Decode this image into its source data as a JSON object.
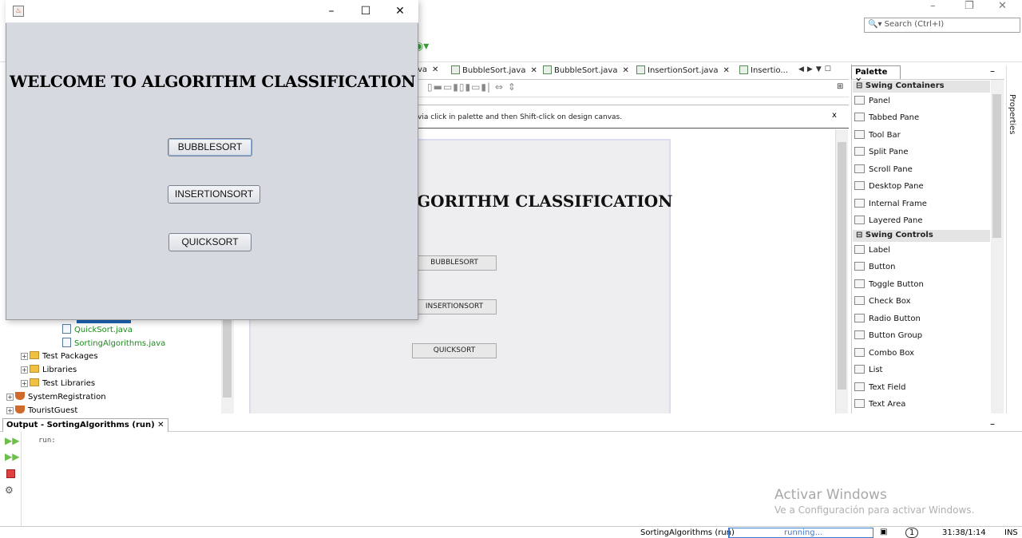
{
  "ide": {
    "search_placeholder": "Search (Ctrl+I)",
    "hint_text": "via click in palette and then Shift-click on design canvas.",
    "hint_close": "x"
  },
  "editor_tabs": [
    {
      "label": "va"
    },
    {
      "label": "BubbleSort.java"
    },
    {
      "label": "BubbleSort.java"
    },
    {
      "label": "InsertionSort.java"
    },
    {
      "label": "Insertio..."
    }
  ],
  "design_canvas": {
    "title": "GORITHM CLASSIFICATION",
    "buttons": [
      "BUBBLESORT",
      "INSERTIONSORT",
      "QUICKSORT"
    ]
  },
  "project_tree": {
    "items": [
      {
        "label": "QuickSort.java"
      },
      {
        "label": "SortingAlgorithms.java"
      },
      {
        "label": "Test Packages"
      },
      {
        "label": "Libraries"
      },
      {
        "label": "Test Libraries"
      },
      {
        "label": "SystemRegistration"
      },
      {
        "label": "TouristGuest"
      }
    ]
  },
  "palette": {
    "tab_label": "Palette",
    "categories": [
      {
        "label": "Swing Containers",
        "items": [
          "Panel",
          "Tabbed Pane",
          "Tool Bar",
          "Split Pane",
          "Scroll Pane",
          "Desktop Pane",
          "Internal Frame",
          "Layered Pane"
        ]
      },
      {
        "label": "Swing Controls",
        "items": [
          "Label",
          "Button",
          "Toggle Button",
          "Check Box",
          "Radio Button",
          "Button Group",
          "Combo Box",
          "List",
          "Text Field",
          "Text Area"
        ]
      }
    ],
    "properties_label": "Properties"
  },
  "output": {
    "tab_label": "Output - SortingAlgorithms (run)",
    "text": "run:",
    "watermark_title": "Activar Windows",
    "watermark_sub": "Ve a Configuración para activar Windows."
  },
  "status": {
    "project": "SortingAlgorithms (run)",
    "progress_text": "running...",
    "notifications": "1",
    "position": "31:38/1:14",
    "mode": "INS"
  },
  "dialog": {
    "heading": "WELCOME TO ALGORITHM CLASSIFICATION",
    "buttons": {
      "bubble": "BUBBLESORT",
      "insertion": "INSERTIONSORT",
      "quick": "QUICKSORT"
    },
    "controls": {
      "minimize": "–",
      "maximize": "☐",
      "close": "✕"
    }
  }
}
